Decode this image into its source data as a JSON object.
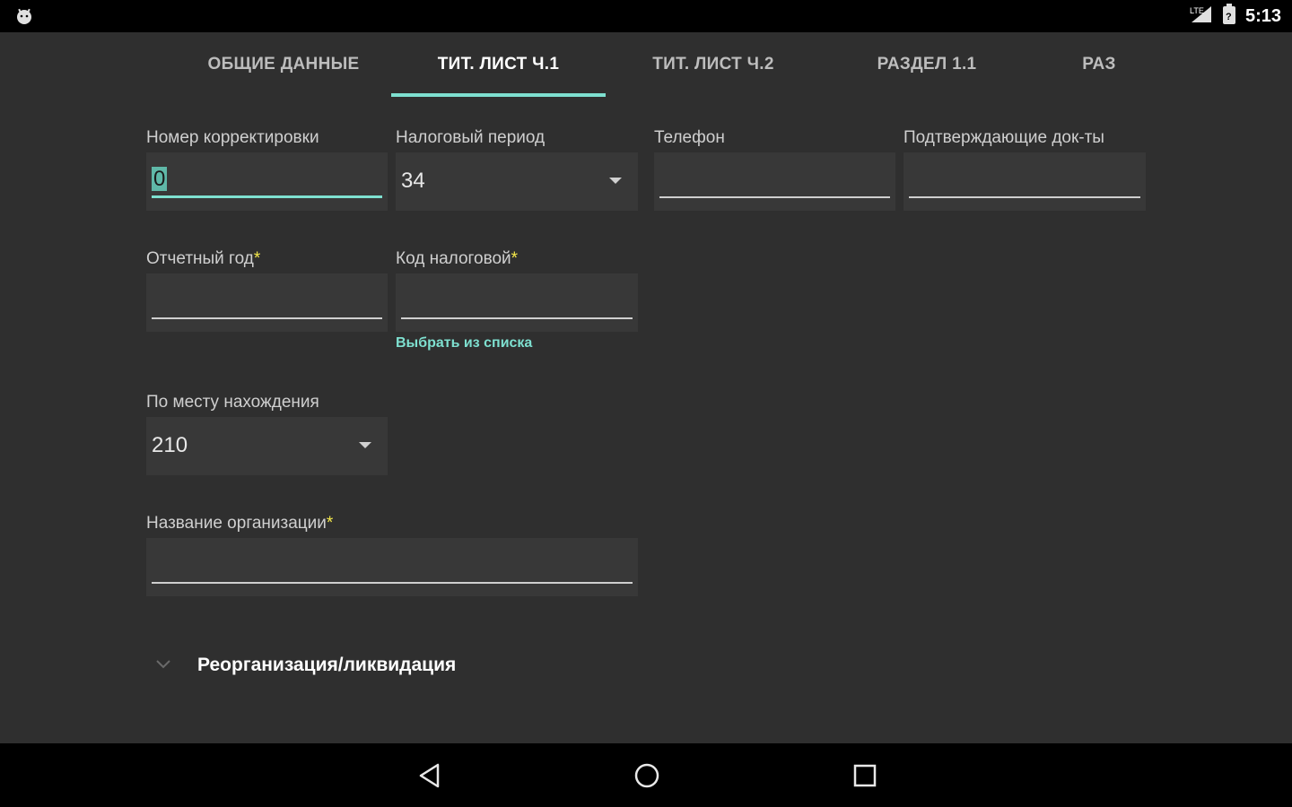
{
  "status": {
    "time": "5:13",
    "left_icon": "android-icon",
    "right_icons": [
      "signal-icon",
      "battery-icon"
    ]
  },
  "tabs": [
    {
      "label": "ОБЩИЕ ДАННЫЕ",
      "active": false
    },
    {
      "label": "ТИТ. ЛИСТ Ч.1",
      "active": true
    },
    {
      "label": "ТИТ. ЛИСТ Ч.2",
      "active": false
    },
    {
      "label": "РАЗДЕЛ 1.1",
      "active": false
    },
    {
      "label": "РАЗ",
      "active": false
    }
  ],
  "form": {
    "correction_number": {
      "label": "Номер корректировки",
      "value": "0"
    },
    "tax_period": {
      "label": "Налоговый период",
      "value": "34"
    },
    "phone": {
      "label": "Телефон",
      "value": ""
    },
    "supporting_docs": {
      "label": "Подтверждающие док-ты",
      "value": ""
    },
    "report_year": {
      "label": "Отчетный год",
      "required_mark": "*",
      "value": ""
    },
    "tax_code": {
      "label": "Код налоговой",
      "required_mark": "*",
      "value": "",
      "link": "Выбрать из списка"
    },
    "location": {
      "label": "По месту нахождения",
      "value": "210"
    },
    "org_name": {
      "label": "Название организации",
      "required_mark": "*",
      "value": ""
    },
    "reorg_section": {
      "title": "Реорганизация/ликвидация",
      "icon": "chevron-down-icon"
    }
  },
  "colors": {
    "accent": "#7ee0d0",
    "required": "#f5e94a",
    "background": "#2f2f2f",
    "field_bg": "#383838"
  },
  "nav": {
    "icons": [
      "back-icon",
      "home-icon",
      "recents-icon"
    ]
  }
}
